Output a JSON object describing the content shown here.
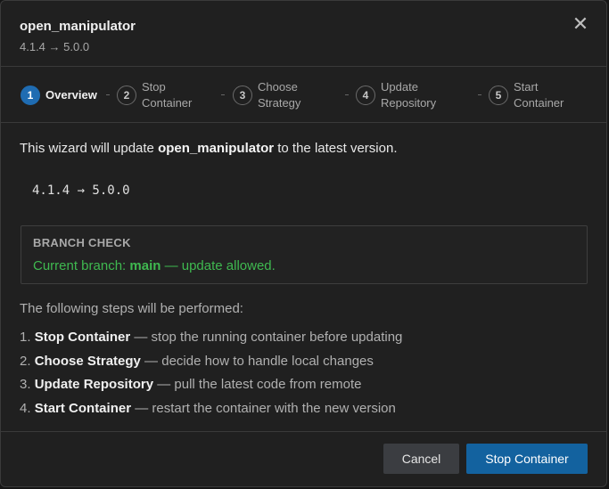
{
  "dialog": {
    "title": "open_manipulator",
    "subtitle": "4.1.4 → 5.0.0",
    "close_glyph": "✕"
  },
  "wizard_steps": [
    {
      "number": "1",
      "label": "Overview",
      "active": true
    },
    {
      "number": "2",
      "label": "Stop Container",
      "active": false
    },
    {
      "number": "3",
      "label": "Choose Strategy",
      "active": false
    },
    {
      "number": "4",
      "label": "Update Repository",
      "active": false
    },
    {
      "number": "5",
      "label": "Start Container",
      "active": false
    }
  ],
  "body": {
    "intro_prefix": "This wizard will update ",
    "intro_package": "open_manipulator",
    "intro_suffix": " to the latest version.",
    "version_change": "4.1.4 → 5.0.0",
    "branch_check": {
      "title": "BRANCH CHECK",
      "prefix": "Current branch: ",
      "branch": "main",
      "suffix": " — update allowed.",
      "status_color": "#3fb950"
    },
    "steps_intro": "The following steps will be performed:",
    "plan": [
      {
        "index": "1. ",
        "name": "Stop Container",
        "desc": " — stop the running container before updating"
      },
      {
        "index": "2. ",
        "name": "Choose Strategy",
        "desc": " — decide how to handle local changes"
      },
      {
        "index": "3. ",
        "name": "Update Repository",
        "desc": " — pull the latest code from remote"
      },
      {
        "index": "4. ",
        "name": "Start Container",
        "desc": " — restart the container with the new version"
      }
    ]
  },
  "footer": {
    "cancel_label": "Cancel",
    "primary_label": "Stop Container",
    "primary_color": "#13629f"
  }
}
